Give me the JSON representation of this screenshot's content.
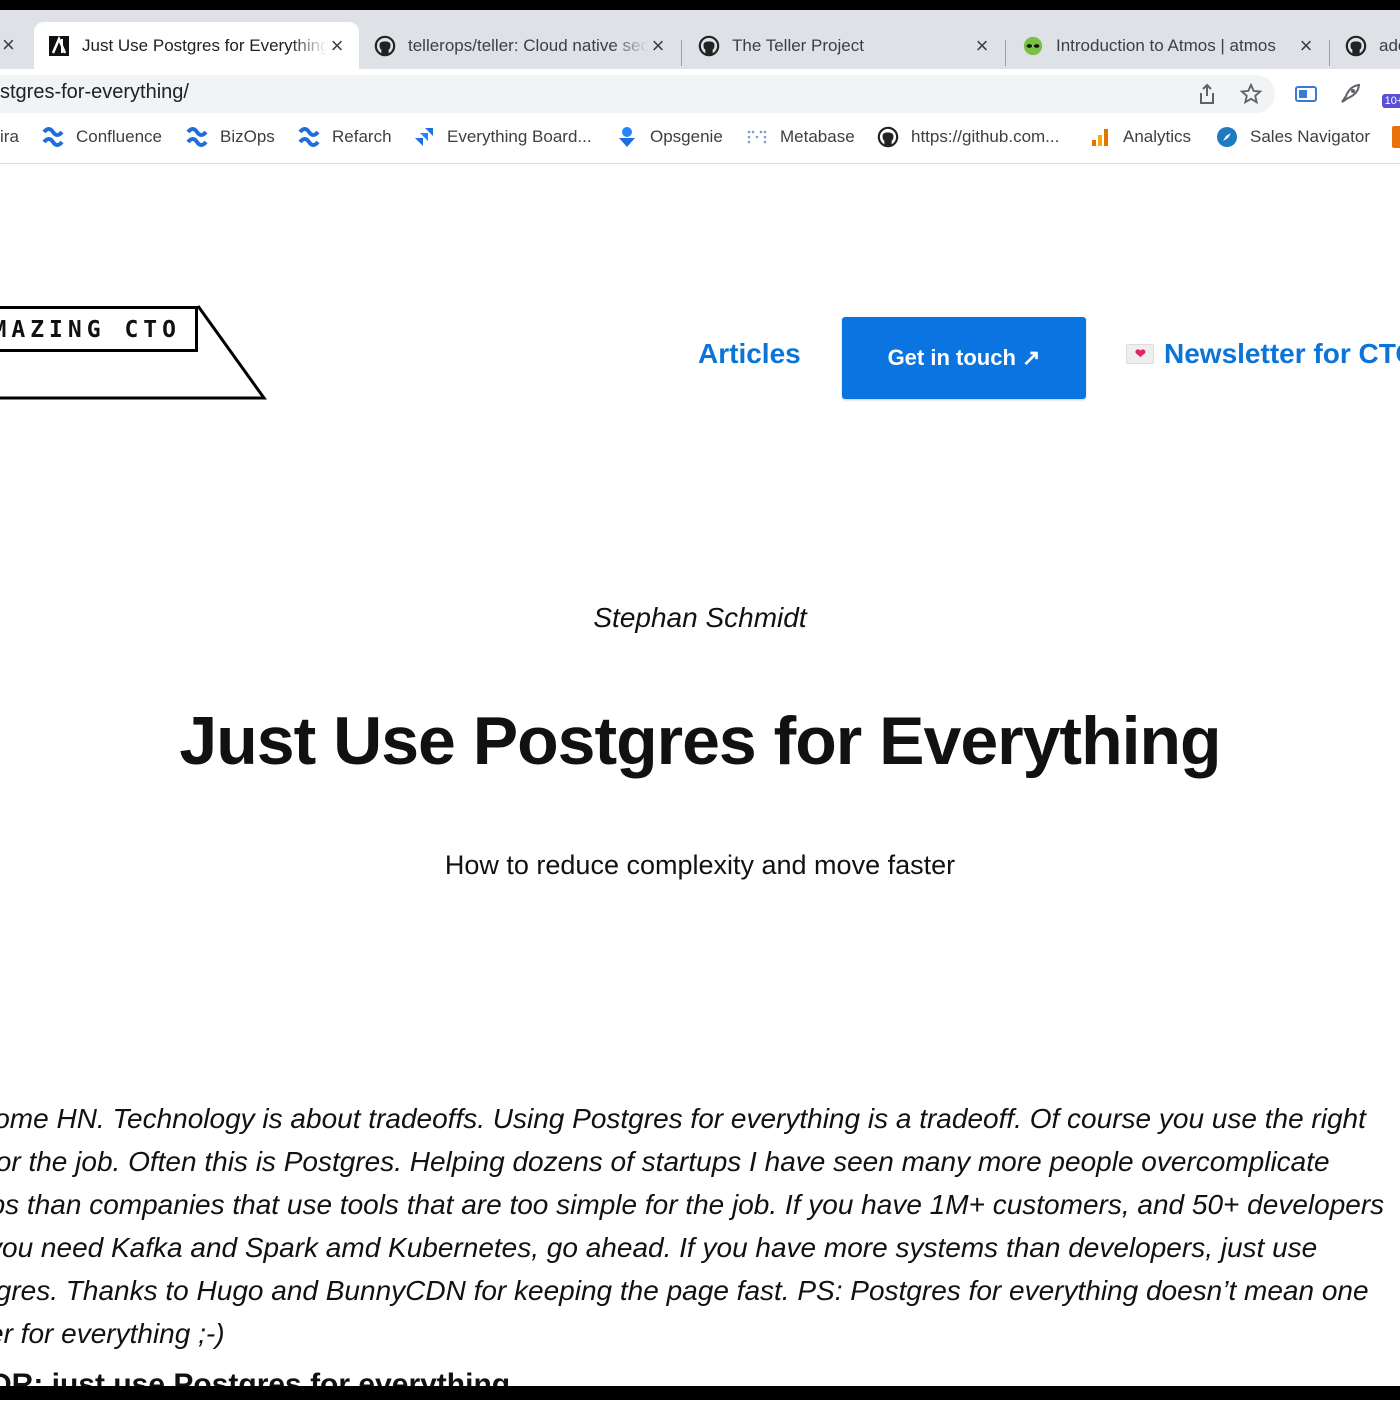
{
  "tabs": [
    {
      "title": "Just Use Postgres for Everything",
      "icon": "amazing-cto-icon",
      "active": true
    },
    {
      "title": "tellerops/teller: Cloud native secrets",
      "icon": "github-icon"
    },
    {
      "title": "The Teller Project",
      "icon": "github-icon"
    },
    {
      "title": "Introduction to Atmos | atmos",
      "icon": "alien-icon"
    },
    {
      "title": "ado",
      "icon": "github-icon"
    }
  ],
  "address": {
    "url": "stgres-for-everything/"
  },
  "bookmarks": [
    {
      "label": "ira",
      "icon": "jira-icon"
    },
    {
      "label": "Confluence",
      "icon": "confluence-icon"
    },
    {
      "label": "BizOps",
      "icon": "confluence-icon"
    },
    {
      "label": "Refarch",
      "icon": "confluence-icon"
    },
    {
      "label": "Everything Board...",
      "icon": "jira-board-icon"
    },
    {
      "label": "Opsgenie",
      "icon": "opsgenie-icon"
    },
    {
      "label": "Metabase",
      "icon": "metabase-icon"
    },
    {
      "label": "https://github.com...",
      "icon": "github-icon"
    },
    {
      "label": "Analytics",
      "icon": "analytics-icon"
    },
    {
      "label": "Sales Navigator",
      "icon": "compass-icon"
    }
  ],
  "extension_badge": "10+",
  "site": {
    "logo": "MAZING CTO",
    "nav_articles": "Articles",
    "cta": "Get in touch ↗",
    "newsletter": "Newsletter for CTO"
  },
  "article": {
    "author": "Stephan Schmidt",
    "title": "Just Use Postgres for Everything",
    "subtitle": "How to reduce complexity and move faster",
    "intro_lines": [
      "lcome HN. Technology is about tradeoffs. Using Postgres for everything is a tradeoff. Of course you use the right",
      "l for the job. Often this is Postgres. Helping dozens of startups I have seen many more people overcomplicate",
      "ups than companies that use tools that are too simple for the job. If you have 1M+ customers, and 50+ developers",
      "l you need Kafka and Spark amd Kubernetes, go ahead. If you have more systems than developers, just use",
      "stgres. Thanks to Hugo and BunnyCDN for keeping the page fast. PS: Postgres for everything doesn’t mean one",
      "ver for everything ;-)"
    ],
    "tldr": "DR: just use Postgres for everything"
  },
  "colors": {
    "accent": "#0a74d9",
    "cta_bg": "#0a74e0"
  }
}
